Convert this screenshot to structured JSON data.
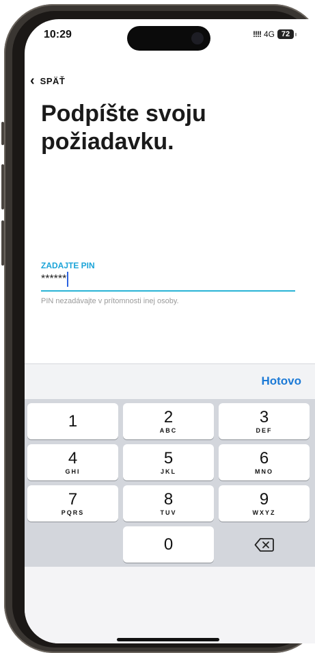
{
  "status_bar": {
    "time": "10:29",
    "signal": "!!!!",
    "network": "4G",
    "battery": "72"
  },
  "nav": {
    "back_label": "SPÄŤ"
  },
  "title": {
    "line1": "Podpíšte svoju",
    "line2": "požiadavku."
  },
  "pin_field": {
    "label": "ZADAJTE PIN",
    "value": "******",
    "hint": "PIN nezadávajte v prítomnosti inej osoby.",
    "accent_color": "#1ba4d8"
  },
  "keyboard": {
    "done_label": "Hotovo",
    "keys": [
      {
        "num": "1",
        "letters": ""
      },
      {
        "num": "2",
        "letters": "ABC"
      },
      {
        "num": "3",
        "letters": "DEF"
      },
      {
        "num": "4",
        "letters": "GHI"
      },
      {
        "num": "5",
        "letters": "JKL"
      },
      {
        "num": "6",
        "letters": "MNO"
      },
      {
        "num": "7",
        "letters": "PQRS"
      },
      {
        "num": "8",
        "letters": "TUV"
      },
      {
        "num": "9",
        "letters": "WXYZ"
      },
      {
        "num": "0",
        "letters": ""
      }
    ],
    "delete_icon": "backspace-icon"
  }
}
